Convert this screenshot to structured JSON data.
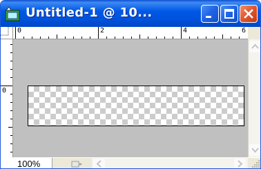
{
  "window": {
    "title": "Untitled-1 @ 10...",
    "colors": {
      "titlebar": "#0054e3",
      "close_button": "#e0562c",
      "canvas_bg": "#c0c0c0",
      "checker": "#cccccc"
    },
    "icons": {
      "app": "photoshop-document-icon",
      "minimize": "minimize-icon",
      "maximize": "maximize-icon",
      "close": "close-icon"
    }
  },
  "rulers": {
    "top_labels": [
      "0",
      "2",
      "4",
      "6"
    ],
    "left_labels": [
      "0"
    ]
  },
  "status": {
    "zoom": "100%",
    "icons": [
      "status-arrow-icon"
    ]
  },
  "scrollbars": {
    "vertical": {
      "up": "scroll-up-icon",
      "down": "scroll-down-icon"
    },
    "horizontal": {
      "left": "scroll-left-icon",
      "right": "scroll-right-icon"
    }
  }
}
